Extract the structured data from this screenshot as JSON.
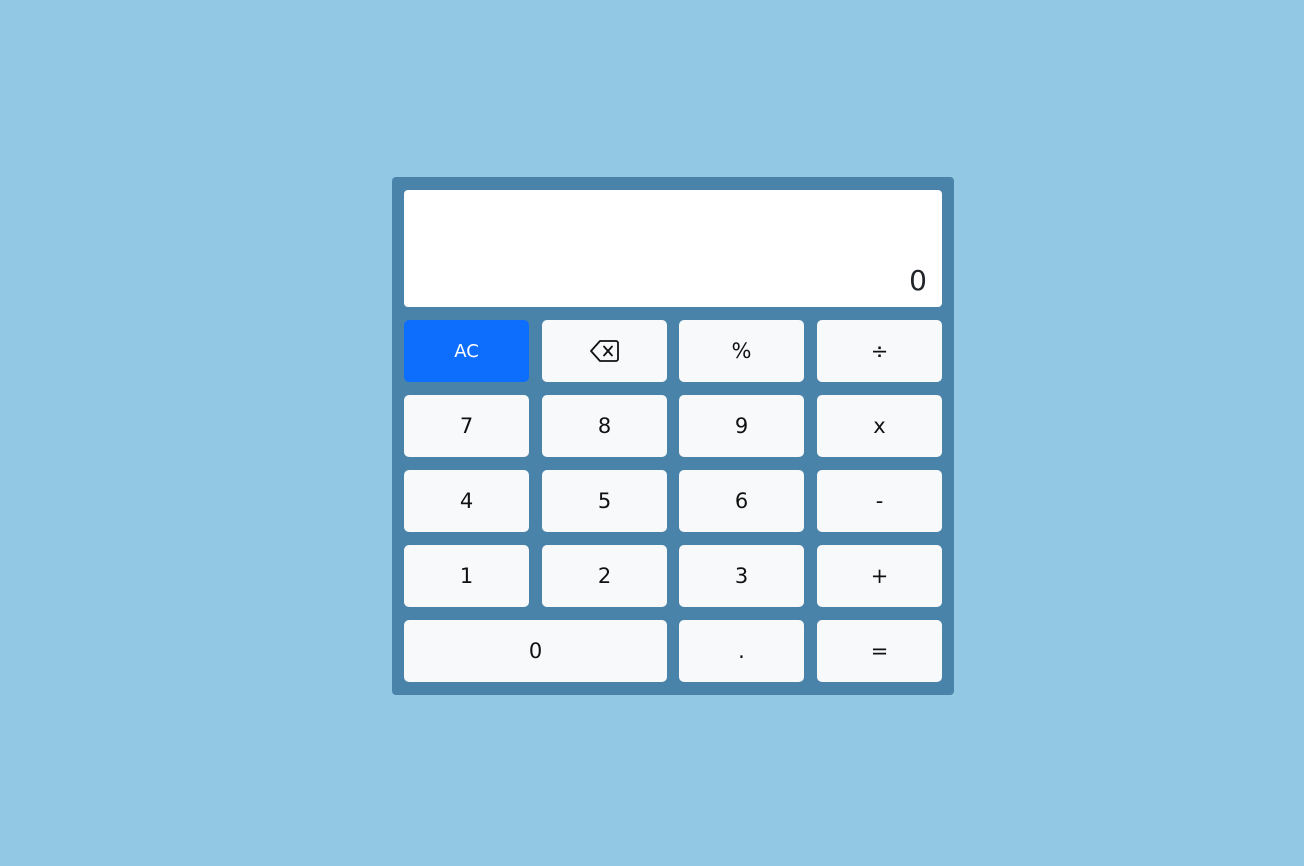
{
  "display": {
    "value": "0"
  },
  "colors": {
    "page_background": "#92c8e3",
    "calculator_body": "#4a83a9",
    "clear_button": "#0d6efd",
    "key_background": "#f8f9fa"
  },
  "keys": {
    "clear": "AC",
    "backspace_icon": "backspace-icon",
    "percent": "%",
    "divide": "÷",
    "seven": "7",
    "eight": "8",
    "nine": "9",
    "multiply": "x",
    "four": "4",
    "five": "5",
    "six": "6",
    "subtract": "-",
    "one": "1",
    "two": "2",
    "three": "3",
    "add": "+",
    "zero": "0",
    "decimal": ".",
    "equals": "="
  }
}
